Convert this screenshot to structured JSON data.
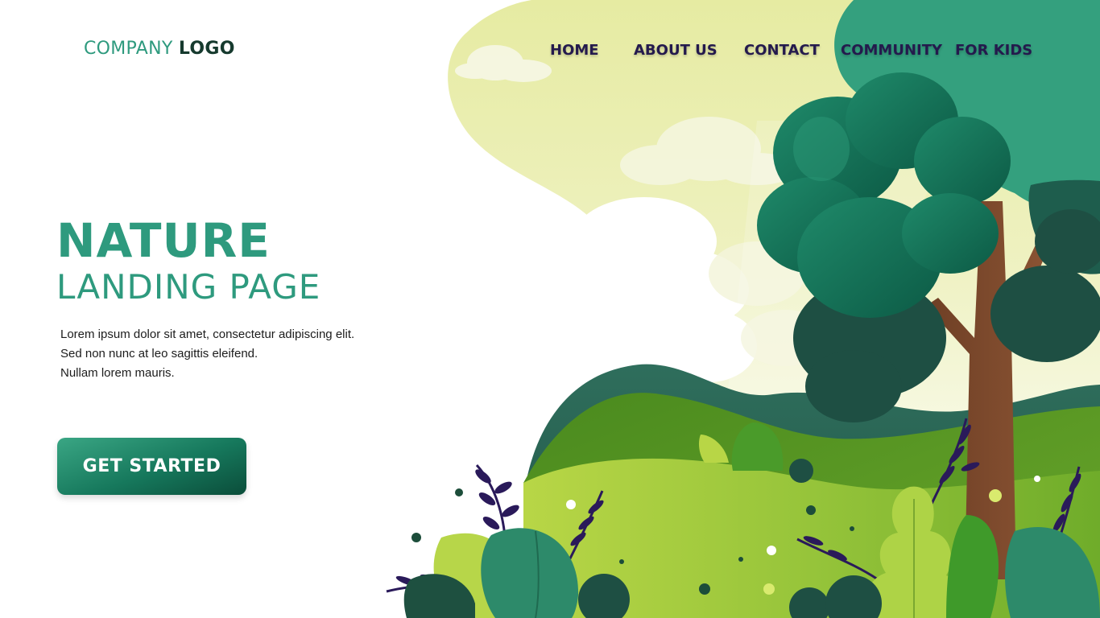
{
  "header": {
    "logo_part1": "COMPANY",
    "logo_part2": "LOGO"
  },
  "nav": {
    "items": [
      {
        "label": "HOME"
      },
      {
        "label": "ABOUT US"
      },
      {
        "label": "CONTACT"
      },
      {
        "label": "COMMUNITY"
      },
      {
        "label": "FOR KIDS"
      }
    ]
  },
  "hero": {
    "title": "NATURE",
    "subtitle": "LANDING PAGE",
    "body_lines": [
      "Lorem ipsum dolor sit amet, consectetur adipiscing elit.",
      "Sed non nunc at leo sagittis eleifend.",
      "Nullam lorem mauris."
    ],
    "cta_label": "GET STARTED"
  },
  "colors": {
    "accent": "#2e9a7e",
    "nav_text": "#241a4d",
    "button_dark": "#0b4d3a",
    "sky": "#e8eca8"
  }
}
